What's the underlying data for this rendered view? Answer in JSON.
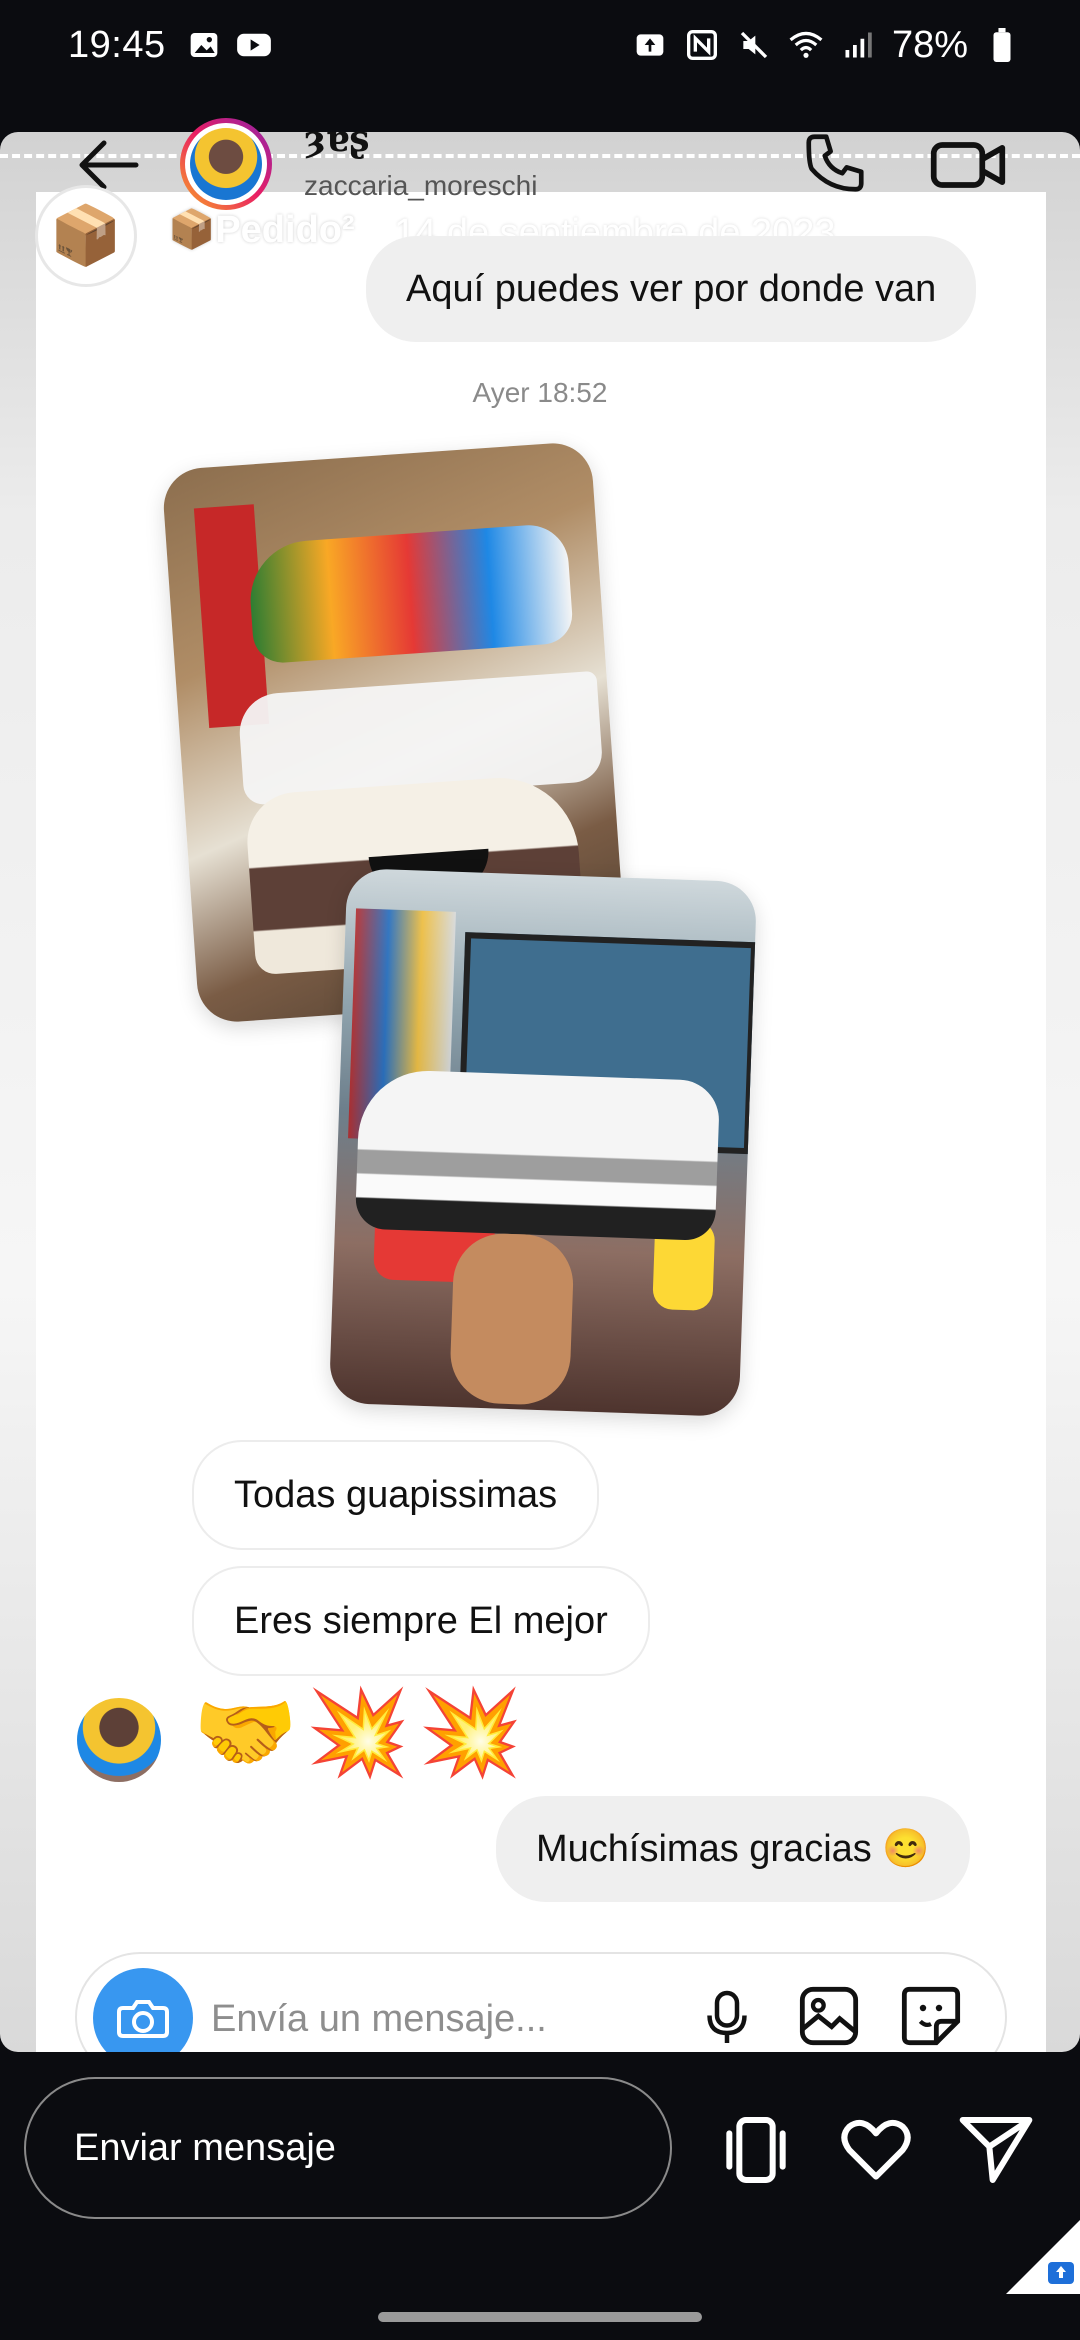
{
  "status_bar": {
    "time": "19:45",
    "battery": "78%"
  },
  "chat": {
    "header": {
      "name": "ȝɐʂ",
      "username": "zaccaria_moreschi"
    },
    "story_overlay": {
      "title": "📦Pedido²",
      "date": "14 de septiembre de 2023"
    },
    "messages": {
      "m1": "Aquí puedes ver por donde van",
      "timestamp": "Ayer 18:52",
      "m2": "Todas guapissimas",
      "m3": "Eres siempre El mejor",
      "m4": "🤝💥💥",
      "m5": "Muchísimas gracias 😊"
    },
    "composer": {
      "placeholder": "Envía un mensaje..."
    }
  },
  "reply": {
    "placeholder": "Enviar mensaje"
  },
  "icons": {
    "back": "arrow-left",
    "call": "phone",
    "video": "video-camera",
    "camera": "camera",
    "mic": "microphone",
    "gallery": "image",
    "sticker": "sticker",
    "share": "send",
    "like": "heart",
    "story_more": "more-vertical"
  },
  "colors": {
    "accent_blue": "#3897f0",
    "outgoing_bubble": "#efefef",
    "dark_bg": "#0b0c10"
  }
}
